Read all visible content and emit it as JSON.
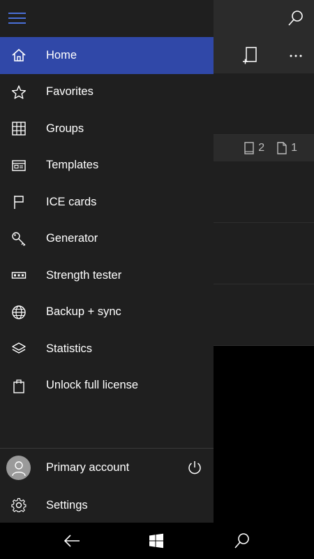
{
  "nav": {
    "items": [
      {
        "label": "Home",
        "icon": "home-icon",
        "active": true
      },
      {
        "label": "Favorites",
        "icon": "star-icon"
      },
      {
        "label": "Groups",
        "icon": "grid-icon"
      },
      {
        "label": "Templates",
        "icon": "template-icon"
      },
      {
        "label": "ICE cards",
        "icon": "flag-icon"
      },
      {
        "label": "Generator",
        "icon": "key-icon"
      },
      {
        "label": "Strength tester",
        "icon": "password-field-icon"
      },
      {
        "label": "Backup + sync",
        "icon": "globe-icon"
      },
      {
        "label": "Statistics",
        "icon": "layers-icon"
      },
      {
        "label": "Unlock full license",
        "icon": "shopping-bag-icon"
      }
    ],
    "footer": {
      "account_label": "Primary account",
      "settings_label": "Settings"
    }
  },
  "background": {
    "counts": {
      "cards": "2",
      "docs": "1"
    }
  },
  "colors": {
    "accent": "#3048a8",
    "hamburger": "#4a70d8",
    "pane": "#1f1f1f"
  }
}
